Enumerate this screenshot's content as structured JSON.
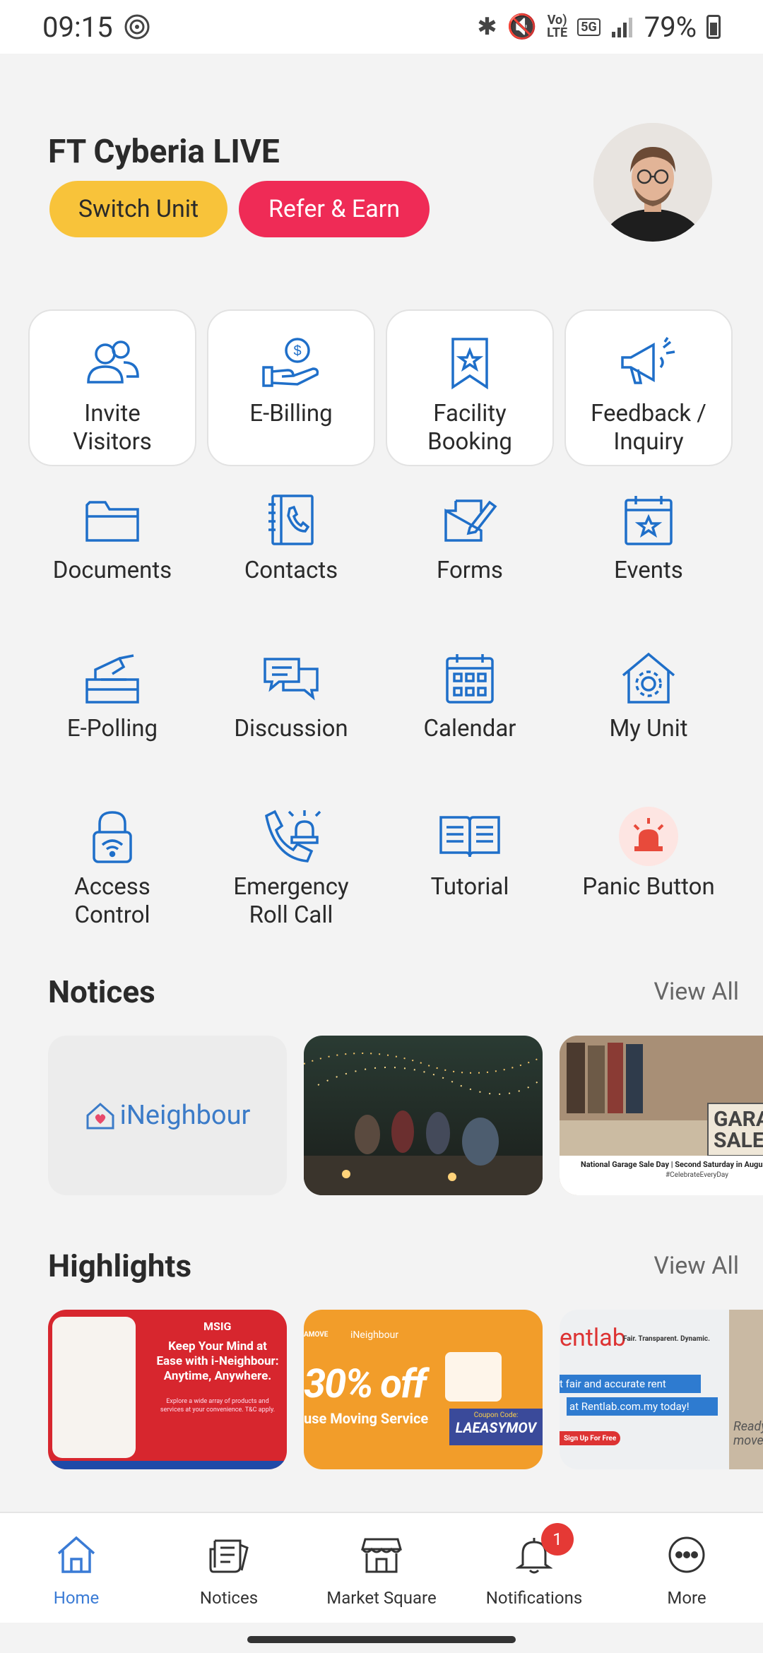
{
  "status_bar": {
    "time": "09:15",
    "battery": "79%"
  },
  "header": {
    "unit_name": "FT Cyberia LIVE",
    "switch_label": "Switch Unit",
    "refer_label": "Refer & Earn"
  },
  "features": [
    {
      "label": "Invite\nVisitors",
      "icon": "visitors-icon"
    },
    {
      "label": "E-Billing",
      "icon": "billing-icon"
    },
    {
      "label": "Facility\nBooking",
      "icon": "bookmark-star-icon"
    },
    {
      "label": "Feedback /\nInquiry",
      "icon": "megaphone-icon"
    },
    {
      "label": "Documents",
      "icon": "folder-icon"
    },
    {
      "label": "Contacts",
      "icon": "contacts-book-icon"
    },
    {
      "label": "Forms",
      "icon": "forms-icon"
    },
    {
      "label": "Events",
      "icon": "event-calendar-icon"
    },
    {
      "label": "E-Polling",
      "icon": "ballot-box-icon"
    },
    {
      "label": "Discussion",
      "icon": "chat-bubbles-icon"
    },
    {
      "label": "Calendar",
      "icon": "calendar-icon"
    },
    {
      "label": "My Unit",
      "icon": "house-gear-icon"
    },
    {
      "label": "Access\nControl",
      "icon": "wifi-lock-icon"
    },
    {
      "label": "Emergency\nRoll Call",
      "icon": "phone-alarm-icon"
    },
    {
      "label": "Tutorial",
      "icon": "open-book-icon"
    },
    {
      "label": "Panic Button",
      "icon": "siren-icon"
    }
  ],
  "notices": {
    "title": "Notices",
    "view_all": "View All",
    "card1_logo": "iNeighbour",
    "card3_caption": "National Garage Sale Day | Second Saturday in August",
    "card3_tag": "#CelebrateEveryDay",
    "card3_sign": "GARAG SALE"
  },
  "highlights": {
    "title": "Highlights",
    "view_all": "View All",
    "card1_brand": "MSIG",
    "card1_headline": "Keep Your Mind at Ease with i-Neighbour: Anytime, Anywhere.",
    "card1_sub": "Explore a wide array of products and services at your convenience. T&C apply.",
    "card2_brand": "iNeighbour",
    "card2_prefix": "AMOVE",
    "card2_offer": "30% off",
    "card2_service": "use Moving Service",
    "card2_coupon_label": "Coupon Code:",
    "card2_coupon": "LAEASYMOV",
    "card3_brand": "entlab",
    "card3_tagline": "Fair. Transparent. Dynamic.",
    "card3_line1": "t fair and accurate rent",
    "card3_line2": "at Rentlab.com.my today!",
    "card3_cta": "Sign Up For Free",
    "card3_note": "Ready to move"
  },
  "bottom_nav": [
    {
      "label": "Home",
      "icon": "home-icon",
      "active": true
    },
    {
      "label": "Notices",
      "icon": "notices-icon"
    },
    {
      "label": "Market Square",
      "icon": "store-icon"
    },
    {
      "label": "Notifications",
      "icon": "bell-icon",
      "badge": "1"
    },
    {
      "label": "More",
      "icon": "more-icon"
    }
  ],
  "colors": {
    "accent": "#1f6fc9",
    "switch": "#f8c33a",
    "refer": "#ef2b56",
    "panic": "#e84a3b"
  }
}
